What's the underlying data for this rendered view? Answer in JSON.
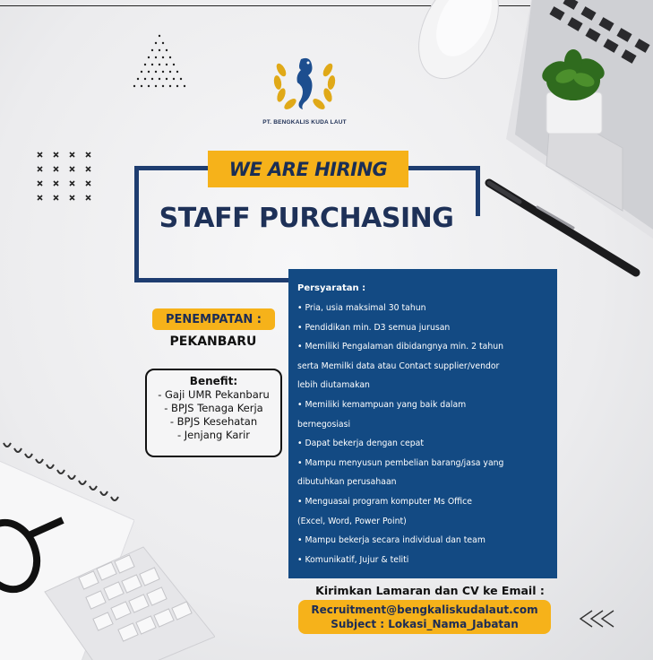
{
  "poster": {
    "company_name": "PT. BENGKALIS KUDA LAUT",
    "hiring_banner": "WE ARE HIRING",
    "job_title": "STAFF PURCHASING",
    "location": {
      "label": "PENEMPATAN :",
      "value": "PEKANBARU"
    },
    "benefit": {
      "title": "Benefit:",
      "items": [
        "- Gaji UMR Pekanbaru",
        "- BPJS Tenaga Kerja",
        "- BPJS Kesehatan",
        "- Jenjang Karir"
      ]
    },
    "requirements": {
      "heading": "Persyaratan :",
      "lines": [
        "• Pria, usia maksimal 30 tahun",
        "• Pendidikan min. D3 semua jurusan",
        "• Memiliki Pengalaman dibidangnya min. 2 tahun",
        "serta Memilki data atau Contact supplier/vendor",
        "lebih diutamakan",
        "• Memiliki kemampuan yang baik dalam",
        "bernegosiasi",
        "• Dapat bekerja dengan cepat",
        "• Mampu menyusun pembelian barang/jasa yang",
        "dibutuhkan perusahaan",
        "• Menguasai program komputer Ms Office",
        "(Excel, Word, Power Point)",
        "• Mampu bekerja secara individual dan team",
        "• Komunikatif, Jujur & teliti"
      ]
    },
    "contact": {
      "heading": "Kirimkan Lamaran dan CV ke Email :",
      "email": "Recruitment@bengkaliskudalaut.com",
      "subject": "Subject : Lokasi_Nama_Jabatan"
    },
    "icons": {
      "logo": "seahorse-logo",
      "rewind": "rewind-arrows-icon"
    },
    "colors": {
      "navy": "#134a83",
      "frame": "#1e3d70",
      "accent": "#f6b21a"
    }
  }
}
